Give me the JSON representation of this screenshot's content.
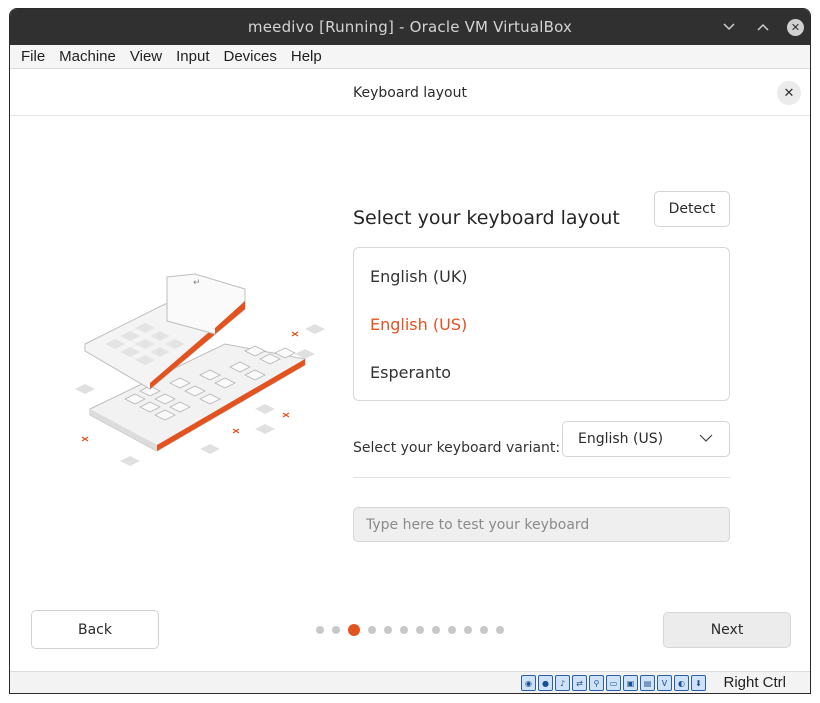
{
  "window": {
    "title": "meedivo [Running] - Oracle VM VirtualBox"
  },
  "menu": [
    "File",
    "Machine",
    "View",
    "Input",
    "Devices",
    "Help"
  ],
  "dialog": {
    "title": "Keyboard layout"
  },
  "content": {
    "heading": "Select your keyboard layout",
    "detect_label": "Detect",
    "layouts": [
      {
        "label": "English (UK)",
        "selected": false
      },
      {
        "label": "English (US)",
        "selected": true
      },
      {
        "label": "Esperanto",
        "selected": false
      }
    ],
    "variant_label": "Select your keyboard variant:",
    "variant_value": "English (US)",
    "test_placeholder": "Type here to test your keyboard"
  },
  "nav": {
    "back_label": "Back",
    "next_label": "Next",
    "steps_total": 12,
    "current_step": 3
  },
  "statusbar": {
    "host_key": "Right Ctrl"
  },
  "colors": {
    "accent": "#e2531f",
    "titlebar": "#303030"
  }
}
